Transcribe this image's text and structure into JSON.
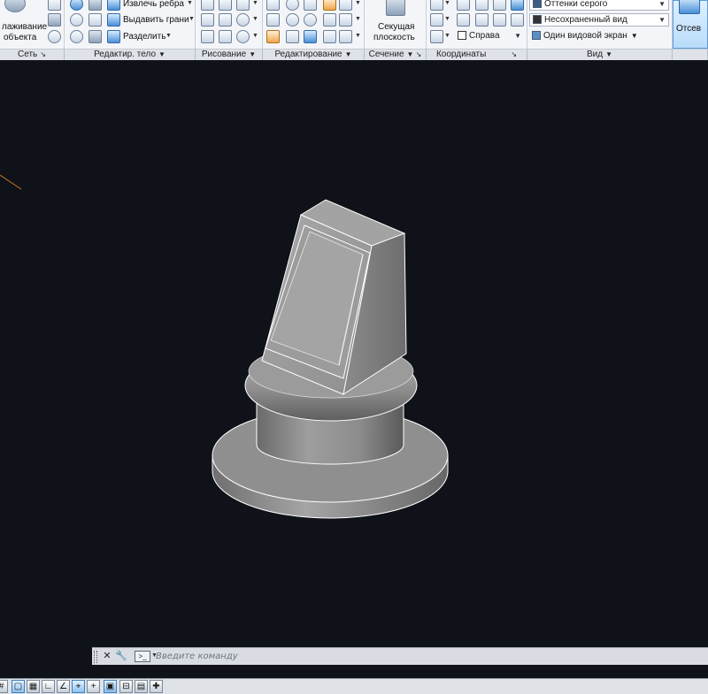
{
  "ribbon": {
    "mesh": {
      "smooth_label_line1": "лаживание",
      "smooth_label_line2": "объекта",
      "title": "Сеть"
    },
    "solid_edit": {
      "extract_edges": "Извлечь ребра",
      "extrude_faces": "Выдавить грани",
      "separate": "Разделить",
      "title": "Редактир. тело"
    },
    "draw": {
      "title": "Рисование"
    },
    "modify": {
      "title": "Редактирование"
    },
    "section": {
      "plane_line1": "Секущая",
      "plane_line2": "плоскость",
      "title": "Сечение"
    },
    "coordinates": {
      "view_right": "Справа",
      "title": "Координаты"
    },
    "view": {
      "visual_style": "Оттенки серого",
      "named_view": "Несохраненный вид",
      "viewport_config": "Один видовой экран",
      "title": "Вид"
    },
    "clip": {
      "label": "Отсев"
    }
  },
  "command_line": {
    "placeholder": "Введите команду"
  },
  "colors": {
    "viewport_bg": "#0f1218",
    "ribbon_bg": "#f3f5f8",
    "model_gray": "#8a8a8a",
    "edge_white": "#ffffff",
    "axis_orange": "#c8742a"
  }
}
